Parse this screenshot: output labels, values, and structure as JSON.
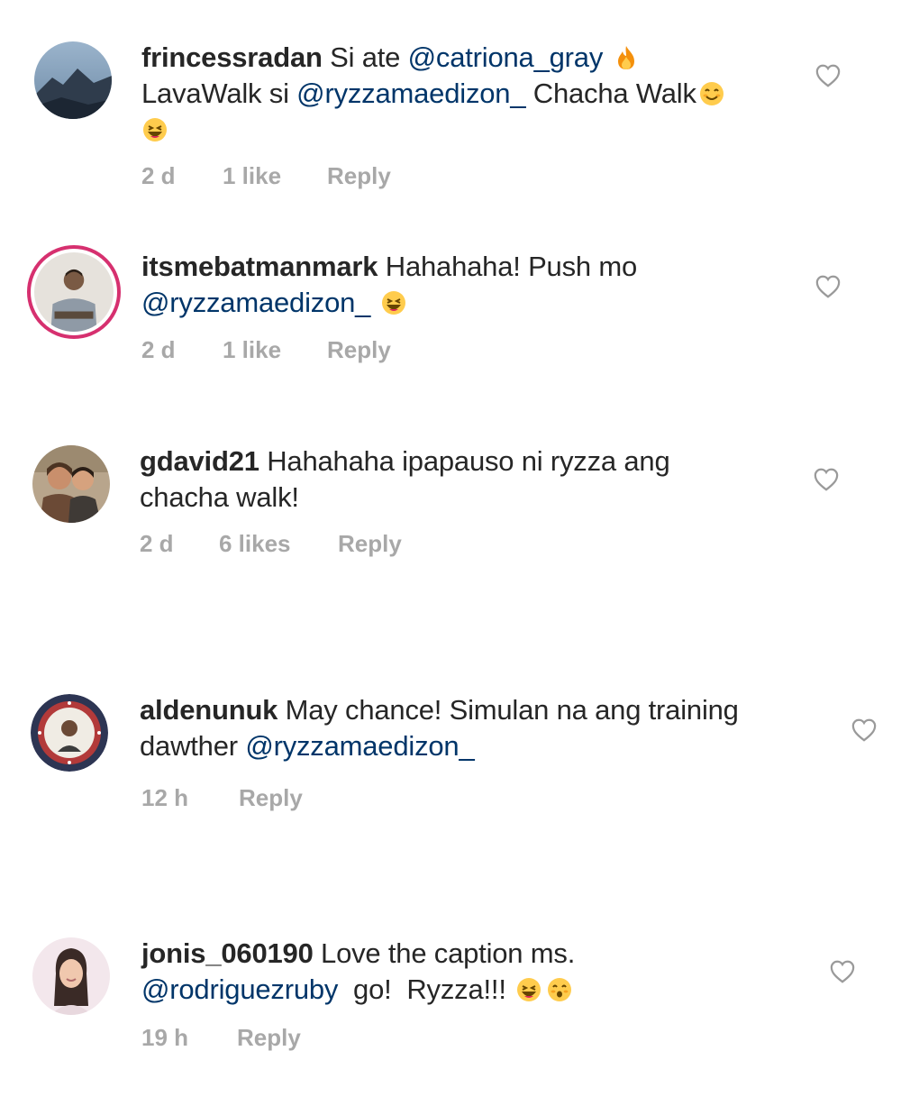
{
  "comments": [
    {
      "username": "frincessradan",
      "line1_pre": "Si ate ",
      "line1_mention": "@catriona_gray",
      "line2_pre": "LavaWalk si ",
      "line2_mention": "@ryzzamaedizon_",
      "line2_post": " Chacha Walk",
      "time": "2 d",
      "likes": "1 like",
      "reply": "Reply"
    },
    {
      "username": "itsmebatmanmark",
      "line1_pre": "Hahahaha! Push mo",
      "line2_mention": "@ryzzamaedizon_",
      "time": "2 d",
      "likes": "1 like",
      "reply": "Reply"
    },
    {
      "username": "gdavid21",
      "line1_pre": "Hahahaha ipapauso ni ryzza ang",
      "line2_pre": "chacha walk!",
      "time": "2 d",
      "likes": "6 likes",
      "reply": "Reply"
    },
    {
      "username": "aldenunuk",
      "line1_pre": "May chance! Simulan na ang training",
      "line2_pre": "dawther ",
      "line2_mention": "@ryzzamaedizon_",
      "time": "12 h",
      "reply": "Reply"
    },
    {
      "username": "jonis_060190",
      "line1_pre": "Love the caption ms.",
      "line2_mention": "@rodriguezruby",
      "line2_post": "  go!  Ryzza!!!",
      "time": "19 h",
      "reply": "Reply"
    }
  ],
  "icons": {
    "like": "heart-outline-icon",
    "fire": "fire-emoji",
    "grin": "grinning-emoji"
  },
  "colors": {
    "text": "#262626",
    "mention": "#003569",
    "meta": "#a8a8a8",
    "story_ring": "#d6306f"
  }
}
